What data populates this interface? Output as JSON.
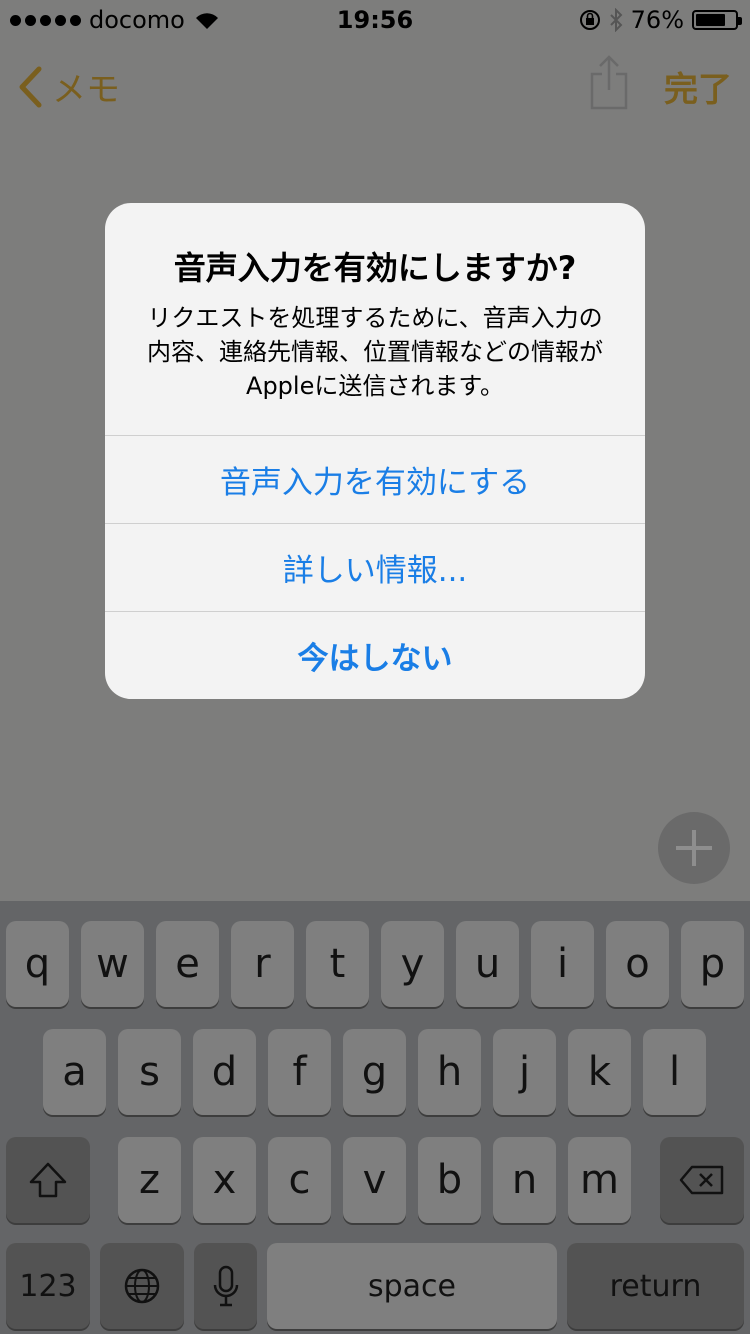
{
  "status_bar": {
    "carrier": "docomo",
    "time": "19:56",
    "battery_percent_label": "76%",
    "battery_level": 0.76
  },
  "nav": {
    "back_label": "メモ",
    "done_label": "完了"
  },
  "alert": {
    "title": "音声入力を有効にしますか?",
    "message_lines": [
      "リクエストを処理するために、音声入力の",
      "内容、連絡先情報、位置情報などの情報が",
      "Appleに送信されます。"
    ],
    "buttons": {
      "enable": "音声入力を有効にする",
      "more_info": "詳しい情報...",
      "not_now": "今はしない"
    }
  },
  "keyboard": {
    "row1": [
      "q",
      "w",
      "e",
      "r",
      "t",
      "y",
      "u",
      "i",
      "o",
      "p"
    ],
    "row2": [
      "a",
      "s",
      "d",
      "f",
      "g",
      "h",
      "j",
      "k",
      "l"
    ],
    "row3": [
      "z",
      "x",
      "c",
      "v",
      "b",
      "n",
      "m"
    ],
    "numbers_label": "123",
    "space_label": "space",
    "return_label": "return"
  },
  "colors": {
    "accent_gold": "#7a5f1e",
    "alert_button_blue": "#1a7ee6"
  }
}
